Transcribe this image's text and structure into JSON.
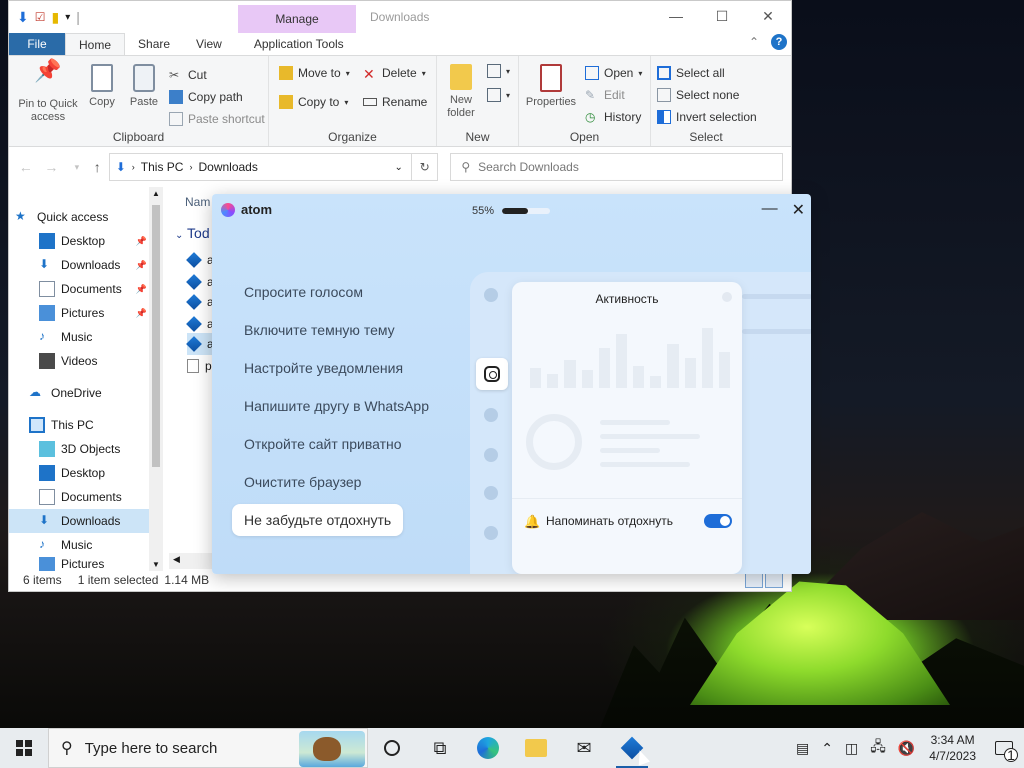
{
  "explorer": {
    "title": "Downloads",
    "manage_tab": "Manage",
    "tabs": {
      "file": "File",
      "home": "Home",
      "share": "Share",
      "view": "View",
      "app_tools": "Application Tools"
    },
    "ribbon": {
      "clipboard": {
        "label": "Clipboard",
        "pin": "Pin to Quick access",
        "copy": "Copy",
        "paste": "Paste",
        "cut": "Cut",
        "copy_path": "Copy path",
        "paste_shortcut": "Paste shortcut"
      },
      "organize": {
        "label": "Organize",
        "move_to": "Move to",
        "copy_to": "Copy to",
        "delete": "Delete",
        "rename": "Rename"
      },
      "new": {
        "label": "New",
        "new_folder": "New folder"
      },
      "open": {
        "label": "Open",
        "properties": "Properties",
        "open": "Open",
        "edit": "Edit",
        "history": "History"
      },
      "select": {
        "label": "Select",
        "select_all": "Select all",
        "select_none": "Select none",
        "invert": "Invert selection"
      }
    },
    "address": {
      "path_root": "This PC",
      "path_leaf": "Downloads"
    },
    "search_placeholder": "Search Downloads",
    "nav": {
      "quick_access": "Quick access",
      "desktop": "Desktop",
      "downloads": "Downloads",
      "documents": "Documents",
      "pictures": "Pictures",
      "music": "Music",
      "videos": "Videos",
      "onedrive": "OneDrive",
      "this_pc": "This PC",
      "objects3d": "3D Objects",
      "desktop2": "Desktop",
      "documents2": "Documents",
      "downloads2": "Downloads",
      "music2": "Music",
      "pictures2": "Pictures"
    },
    "column_name": "Nam",
    "group_today": "Tod",
    "files": [
      "a",
      "a",
      "a",
      "a",
      "a",
      "p"
    ],
    "status": {
      "items": "6 items",
      "selected": "1 item selected",
      "size": "1.14 MB"
    }
  },
  "atom": {
    "brand": "atom",
    "progress_label": "55%",
    "progress_value": 0.55,
    "hints": [
      "Спросите голосом",
      "Включите темную тему",
      "Настройте уведомления",
      "Напишите другу в WhatsApp",
      "Откройте сайт приватно",
      "Очистите браузер",
      "Не забудьте отдохнуть"
    ],
    "card_title": "Активность",
    "reminder_label": "Напоминать отдохнуть"
  },
  "taskbar": {
    "search_placeholder": "Type here to search",
    "time": "3:34 AM",
    "date": "4/7/2023",
    "notification_count": "1"
  },
  "colors": {
    "accent": "#1e6dd8",
    "file_tab": "#2a6ba8",
    "manage_tab": "#e8c8f6"
  }
}
